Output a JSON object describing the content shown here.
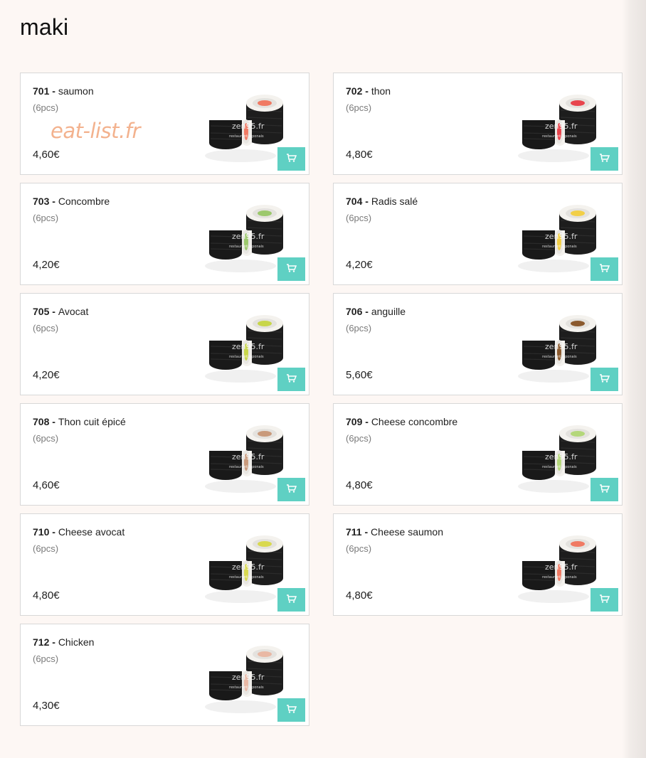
{
  "page": {
    "title": "maki",
    "accent_color": "#5fd0c3",
    "watermark": "eat-list.fr"
  },
  "products": [
    {
      "code": "701",
      "name": "saumon",
      "portion": "(6pcs)",
      "price": "4,60€",
      "filling": "salmon",
      "filling_color": "#f07a63",
      "image_caption": "zen95.fr",
      "image_subcaption": "restaurant japonais"
    },
    {
      "code": "702",
      "name": "thon",
      "portion": "(6pcs)",
      "price": "4,80€",
      "filling": "tuna",
      "filling_color": "#e8454d",
      "image_caption": "zen95.fr",
      "image_subcaption": "restaurant japonais"
    },
    {
      "code": "703",
      "name": "Concombre",
      "portion": "(6pcs)",
      "price": "4,20€",
      "filling": "cucumber",
      "filling_color": "#9cc86c",
      "image_caption": "zen95.fr",
      "image_subcaption": "restaurant japonais"
    },
    {
      "code": "704",
      "name": "Radis salé",
      "portion": "(6pcs)",
      "price": "4,20€",
      "filling": "pickled-radish",
      "filling_color": "#f2cf47",
      "image_caption": "zen95.fr",
      "image_subcaption": "restaurant japonais"
    },
    {
      "code": "705",
      "name": "Avocat",
      "portion": "(6pcs)",
      "price": "4,20€",
      "filling": "avocado",
      "filling_color": "#c8d64a",
      "image_caption": "zen95.fr",
      "image_subcaption": "restaurant japonais"
    },
    {
      "code": "706",
      "name": "anguille",
      "portion": "(6pcs)",
      "price": "5,60€",
      "filling": "eel",
      "filling_color": "#8b5a2e",
      "image_caption": "zen95.fr",
      "image_subcaption": "restaurant japonais"
    },
    {
      "code": "708",
      "name": "Thon cuit épicé",
      "portion": "(6pcs)",
      "price": "4,60€",
      "filling": "spicy-cooked-tuna",
      "filling_color": "#c99a7b",
      "image_caption": "zen95.fr",
      "image_subcaption": "restaurant japonais"
    },
    {
      "code": "709",
      "name": "Cheese concombre",
      "portion": "(6pcs)",
      "price": "4,80€",
      "filling": "cheese-cucumber",
      "filling_color": "#b4d77a",
      "image_caption": "zen95.fr",
      "image_subcaption": "restaurant japonais"
    },
    {
      "code": "710",
      "name": "Cheese avocat",
      "portion": "(6pcs)",
      "price": "4,80€",
      "filling": "cheese-avocado",
      "filling_color": "#d9d94f",
      "image_caption": "zen95.fr",
      "image_subcaption": "restaurant japonais"
    },
    {
      "code": "711",
      "name": "Cheese saumon",
      "portion": "(6pcs)",
      "price": "4,80€",
      "filling": "cheese-salmon",
      "filling_color": "#f07a63",
      "image_caption": "zen95.fr",
      "image_subcaption": "restaurant japonais"
    },
    {
      "code": "712",
      "name": "Chicken",
      "portion": "(6pcs)",
      "price": "4,30€",
      "filling": "chicken",
      "filling_color": "#e9b8a4",
      "image_caption": "zen95.fr",
      "image_subcaption": "restaurant japonais"
    }
  ],
  "icons": {
    "cart_button": "shopping-cart-icon"
  }
}
